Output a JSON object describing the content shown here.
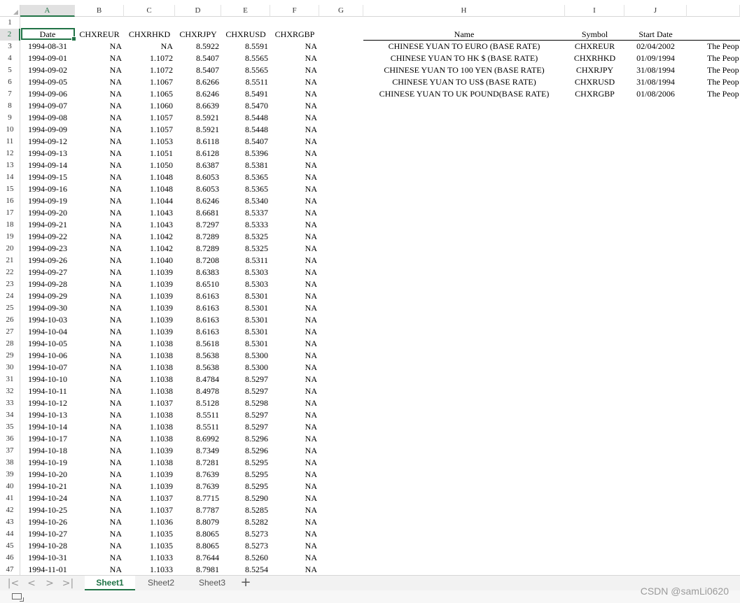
{
  "columns": [
    "A",
    "B",
    "C",
    "D",
    "E",
    "F",
    "G",
    "H",
    "I",
    "J"
  ],
  "selected_column": "A",
  "selected_row": "2",
  "row_numbers": [
    "1",
    "2",
    "3",
    "4",
    "5",
    "6",
    "7",
    "8",
    "9",
    "10",
    "11",
    "12",
    "13",
    "14",
    "15",
    "16",
    "17",
    "18",
    "19",
    "20",
    "21",
    "22",
    "23",
    "24",
    "25",
    "26",
    "27",
    "28",
    "29",
    "30",
    "31",
    "32",
    "33",
    "34",
    "35",
    "36",
    "37",
    "38",
    "39",
    "40",
    "41",
    "42",
    "43",
    "44",
    "45",
    "46",
    "47"
  ],
  "data_headers": [
    "Date",
    "CHXREUR",
    "CHXRHKD",
    "CHXRJPY",
    "CHXRUSD",
    "CHXRGBP"
  ],
  "data_rows": [
    [
      "1994-08-31",
      "NA",
      "NA",
      "8.5922",
      "8.5591",
      "NA"
    ],
    [
      "1994-09-01",
      "NA",
      "1.1072",
      "8.5407",
      "8.5565",
      "NA"
    ],
    [
      "1994-09-02",
      "NA",
      "1.1072",
      "8.5407",
      "8.5565",
      "NA"
    ],
    [
      "1994-09-05",
      "NA",
      "1.1067",
      "8.6266",
      "8.5511",
      "NA"
    ],
    [
      "1994-09-06",
      "NA",
      "1.1065",
      "8.6246",
      "8.5491",
      "NA"
    ],
    [
      "1994-09-07",
      "NA",
      "1.1060",
      "8.6639",
      "8.5470",
      "NA"
    ],
    [
      "1994-09-08",
      "NA",
      "1.1057",
      "8.5921",
      "8.5448",
      "NA"
    ],
    [
      "1994-09-09",
      "NA",
      "1.1057",
      "8.5921",
      "8.5448",
      "NA"
    ],
    [
      "1994-09-12",
      "NA",
      "1.1053",
      "8.6118",
      "8.5407",
      "NA"
    ],
    [
      "1994-09-13",
      "NA",
      "1.1051",
      "8.6128",
      "8.5396",
      "NA"
    ],
    [
      "1994-09-14",
      "NA",
      "1.1050",
      "8.6387",
      "8.5381",
      "NA"
    ],
    [
      "1994-09-15",
      "NA",
      "1.1048",
      "8.6053",
      "8.5365",
      "NA"
    ],
    [
      "1994-09-16",
      "NA",
      "1.1048",
      "8.6053",
      "8.5365",
      "NA"
    ],
    [
      "1994-09-19",
      "NA",
      "1.1044",
      "8.6246",
      "8.5340",
      "NA"
    ],
    [
      "1994-09-20",
      "NA",
      "1.1043",
      "8.6681",
      "8.5337",
      "NA"
    ],
    [
      "1994-09-21",
      "NA",
      "1.1043",
      "8.7297",
      "8.5333",
      "NA"
    ],
    [
      "1994-09-22",
      "NA",
      "1.1042",
      "8.7289",
      "8.5325",
      "NA"
    ],
    [
      "1994-09-23",
      "NA",
      "1.1042",
      "8.7289",
      "8.5325",
      "NA"
    ],
    [
      "1994-09-26",
      "NA",
      "1.1040",
      "8.7208",
      "8.5311",
      "NA"
    ],
    [
      "1994-09-27",
      "NA",
      "1.1039",
      "8.6383",
      "8.5303",
      "NA"
    ],
    [
      "1994-09-28",
      "NA",
      "1.1039",
      "8.6510",
      "8.5303",
      "NA"
    ],
    [
      "1994-09-29",
      "NA",
      "1.1039",
      "8.6163",
      "8.5301",
      "NA"
    ],
    [
      "1994-09-30",
      "NA",
      "1.1039",
      "8.6163",
      "8.5301",
      "NA"
    ],
    [
      "1994-10-03",
      "NA",
      "1.1039",
      "8.6163",
      "8.5301",
      "NA"
    ],
    [
      "1994-10-04",
      "NA",
      "1.1039",
      "8.6163",
      "8.5301",
      "NA"
    ],
    [
      "1994-10-05",
      "NA",
      "1.1038",
      "8.5618",
      "8.5301",
      "NA"
    ],
    [
      "1994-10-06",
      "NA",
      "1.1038",
      "8.5638",
      "8.5300",
      "NA"
    ],
    [
      "1994-10-07",
      "NA",
      "1.1038",
      "8.5638",
      "8.5300",
      "NA"
    ],
    [
      "1994-10-10",
      "NA",
      "1.1038",
      "8.4784",
      "8.5297",
      "NA"
    ],
    [
      "1994-10-11",
      "NA",
      "1.1038",
      "8.4978",
      "8.5297",
      "NA"
    ],
    [
      "1994-10-12",
      "NA",
      "1.1037",
      "8.5128",
      "8.5298",
      "NA"
    ],
    [
      "1994-10-13",
      "NA",
      "1.1038",
      "8.5511",
      "8.5297",
      "NA"
    ],
    [
      "1994-10-14",
      "NA",
      "1.1038",
      "8.5511",
      "8.5297",
      "NA"
    ],
    [
      "1994-10-17",
      "NA",
      "1.1038",
      "8.6992",
      "8.5296",
      "NA"
    ],
    [
      "1994-10-18",
      "NA",
      "1.1039",
      "8.7349",
      "8.5296",
      "NA"
    ],
    [
      "1994-10-19",
      "NA",
      "1.1038",
      "8.7281",
      "8.5295",
      "NA"
    ],
    [
      "1994-10-20",
      "NA",
      "1.1039",
      "8.7639",
      "8.5295",
      "NA"
    ],
    [
      "1994-10-21",
      "NA",
      "1.1039",
      "8.7639",
      "8.5295",
      "NA"
    ],
    [
      "1994-10-24",
      "NA",
      "1.1037",
      "8.7715",
      "8.5290",
      "NA"
    ],
    [
      "1994-10-25",
      "NA",
      "1.1037",
      "8.7787",
      "8.5285",
      "NA"
    ],
    [
      "1994-10-26",
      "NA",
      "1.1036",
      "8.8079",
      "8.5282",
      "NA"
    ],
    [
      "1994-10-27",
      "NA",
      "1.1035",
      "8.8065",
      "8.5273",
      "NA"
    ],
    [
      "1994-10-28",
      "NA",
      "1.1035",
      "8.8065",
      "8.5273",
      "NA"
    ],
    [
      "1994-10-31",
      "NA",
      "1.1033",
      "8.7644",
      "8.5260",
      "NA"
    ],
    [
      "1994-11-01",
      "NA",
      "1.1033",
      "8.7981",
      "8.5254",
      "NA"
    ]
  ],
  "meta_headers": [
    "Name",
    "Symbol",
    "Start Date"
  ],
  "meta_rows": [
    [
      "CHINESE YUAN TO EURO (BASE RATE)",
      "CHXREUR",
      "02/04/2002",
      "The Peop"
    ],
    [
      "CHINESE YUAN TO HK $ (BASE RATE)",
      "CHXRHKD",
      "01/09/1994",
      "The Peop"
    ],
    [
      "CHINESE YUAN TO 100 YEN (BASE RATE)",
      "CHXRJPY",
      "31/08/1994",
      "The Peop"
    ],
    [
      "CHINESE YUAN TO US$ (BASE RATE)",
      "CHXRUSD",
      "31/08/1994",
      "The Peop"
    ],
    [
      "CHINESE YUAN TO UK POUND(BASE RATE)",
      "CHXRGBP",
      "01/08/2006",
      "The Peop"
    ]
  ],
  "tabs": {
    "nav": [
      "|<",
      "<",
      ">",
      ">|"
    ],
    "sheets": [
      "Sheet1",
      "Sheet2",
      "Sheet3"
    ],
    "active": "Sheet1",
    "add": "+"
  },
  "watermark": "CSDN @samLi0620",
  "accent_color": "#217346"
}
